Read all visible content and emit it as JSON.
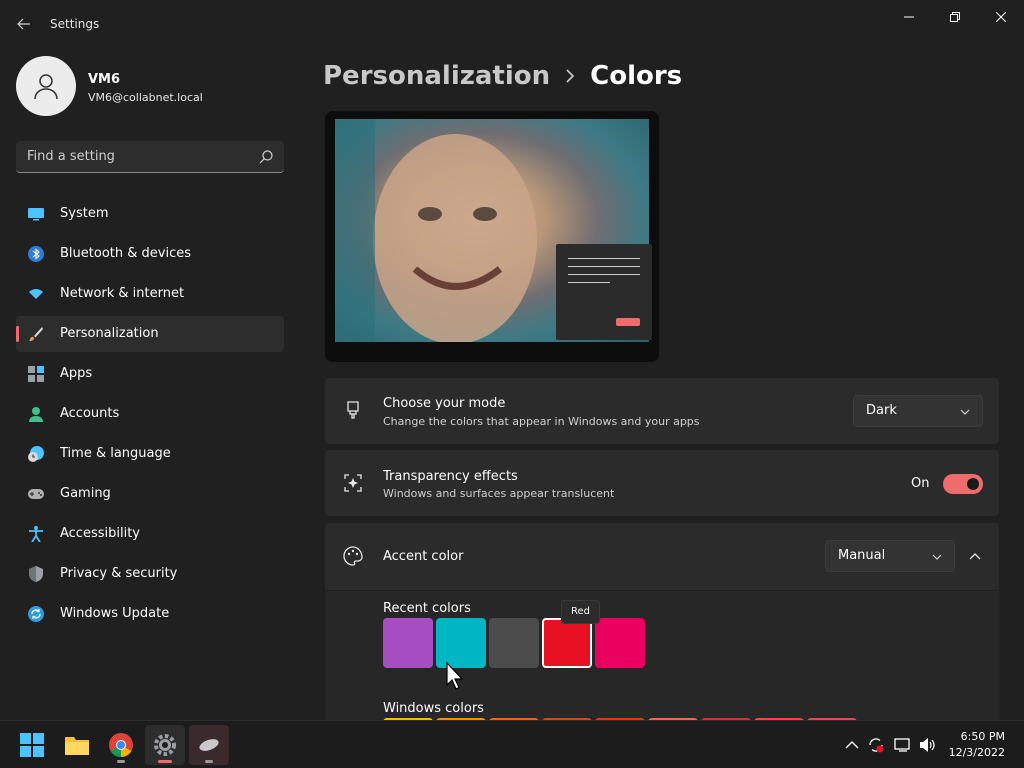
{
  "app": {
    "title": "Settings"
  },
  "profile": {
    "name": "VM6",
    "email": "VM6@collabnet.local"
  },
  "search": {
    "placeholder": "Find a setting"
  },
  "sidebar": {
    "items": [
      {
        "label": "System",
        "icon": "monitor-icon"
      },
      {
        "label": "Bluetooth & devices",
        "icon": "bluetooth-icon"
      },
      {
        "label": "Network & internet",
        "icon": "wifi-icon"
      },
      {
        "label": "Personalization",
        "icon": "brush-icon",
        "active": true
      },
      {
        "label": "Apps",
        "icon": "apps-icon"
      },
      {
        "label": "Accounts",
        "icon": "person-icon"
      },
      {
        "label": "Time & language",
        "icon": "clock-globe-icon"
      },
      {
        "label": "Gaming",
        "icon": "gamepad-icon"
      },
      {
        "label": "Accessibility",
        "icon": "accessibility-icon"
      },
      {
        "label": "Privacy & security",
        "icon": "shield-icon"
      },
      {
        "label": "Windows Update",
        "icon": "update-icon"
      }
    ]
  },
  "breadcrumb": {
    "parent": "Personalization",
    "current": "Colors"
  },
  "mode": {
    "title": "Choose your mode",
    "subtitle": "Change the colors that appear in Windows and your apps",
    "value": "Dark"
  },
  "transparency": {
    "title": "Transparency effects",
    "subtitle": "Windows and surfaces appear translucent",
    "state_label": "On"
  },
  "accent": {
    "title": "Accent color",
    "value": "Manual",
    "recent_label": "Recent colors",
    "windows_label": "Windows colors",
    "tooltip": "Red",
    "recent_colors": [
      "#a64dc1",
      "#00b7c3",
      "#4c4c4c",
      "#e81123",
      "#ea005e"
    ],
    "windows_colors": [
      "#ffb900",
      "#ff8c00",
      "#f7630c",
      "#ca5010",
      "#da3b01",
      "#ef6950",
      "#d13438",
      "#ff4343",
      "#e74856"
    ]
  },
  "colors": {
    "accent": "#ef6c6c",
    "background": "#202020",
    "card": "#2b2b2b"
  },
  "taskbar": {
    "time": "6:50 PM",
    "date": "12/3/2022"
  }
}
